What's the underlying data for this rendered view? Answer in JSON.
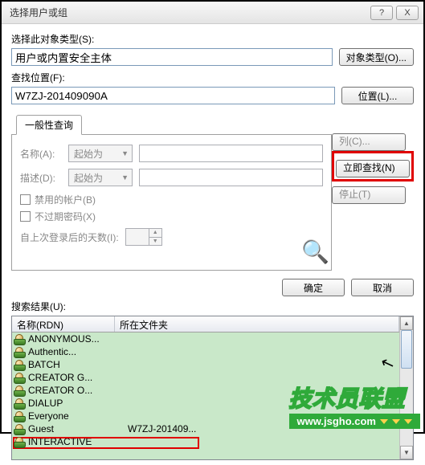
{
  "title": "选择用户或组",
  "section1_label": "选择此对象类型(S):",
  "object_type_value": "用户或内置安全主体",
  "object_type_btn": "对象类型(O)...",
  "section2_label": "查找位置(F):",
  "location_value": "W7ZJ-201409090A",
  "location_btn": "位置(L)...",
  "tab_label": "一般性查询",
  "name_label": "名称(A):",
  "name_mode": "起始为",
  "desc_label": "描述(D):",
  "desc_mode": "起始为",
  "chk_disabled": "禁用的帐户(B)",
  "chk_noexpire": "不过期密码(X)",
  "lastlogin_label": "自上次登录后的天数(I):",
  "btn_columns": "列(C)...",
  "btn_findnow": "立即查找(N)",
  "btn_stop": "停止(T)",
  "btn_ok": "确定",
  "btn_cancel": "取消",
  "results_label": "搜索结果(U):",
  "col_name": "名称(RDN)",
  "col_folder": "所在文件夹",
  "rows": [
    {
      "name": "ANONYMOUS...",
      "folder": ""
    },
    {
      "name": "Authentic...",
      "folder": ""
    },
    {
      "name": "BATCH",
      "folder": ""
    },
    {
      "name": "CREATOR G...",
      "folder": ""
    },
    {
      "name": "CREATOR O...",
      "folder": ""
    },
    {
      "name": "DIALUP",
      "folder": ""
    },
    {
      "name": "Everyone",
      "folder": ""
    },
    {
      "name": "Guest",
      "folder": "W7ZJ-201409..."
    },
    {
      "name": "INTERACTIVE",
      "folder": ""
    }
  ],
  "watermark_text": "技术员联盟",
  "watermark_url": "www.jsgho.com"
}
